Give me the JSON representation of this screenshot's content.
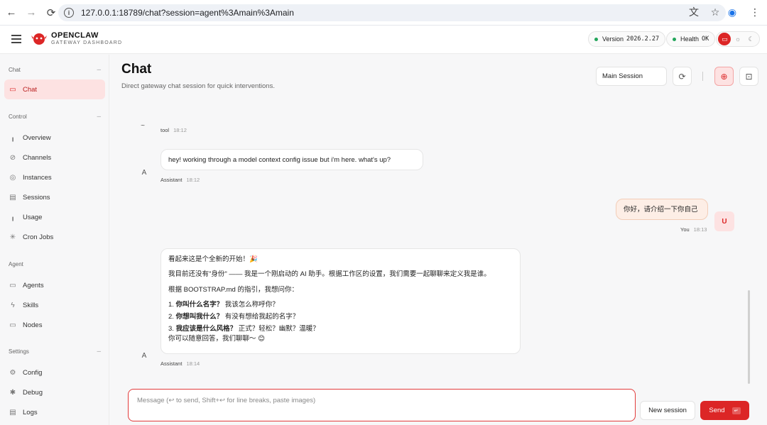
{
  "browser": {
    "url": "127.0.0.1:18789/chat?session=agent%3Amain%3Amain",
    "back_icon": "arrow-left-icon",
    "forward_icon": "arrow-right-icon",
    "reload_icon": "reload-icon"
  },
  "header": {
    "brand_title": "OPENCLAW",
    "brand_subtitle": "GATEWAY DASHBOARD",
    "version_label": "Version",
    "version_value": "2026.2.27",
    "health_label": "Health",
    "health_value": "OK",
    "status_color": "#22a55a",
    "accent_color": "#dc2626"
  },
  "sidebar": {
    "sections": [
      {
        "title": "Chat",
        "items": [
          {
            "label": "Chat",
            "icon": "chat-icon",
            "active": true
          }
        ]
      },
      {
        "title": "Control",
        "items": [
          {
            "label": "Overview",
            "icon": "bar-chart-icon"
          },
          {
            "label": "Channels",
            "icon": "link-icon"
          },
          {
            "label": "Instances",
            "icon": "radio-icon"
          },
          {
            "label": "Sessions",
            "icon": "file-icon"
          },
          {
            "label": "Usage",
            "icon": "bar-chart-icon"
          },
          {
            "label": "Cron Jobs",
            "icon": "loader-icon"
          }
        ]
      },
      {
        "title": "Agent",
        "items": [
          {
            "label": "Agents",
            "icon": "folder-icon"
          },
          {
            "label": "Skills",
            "icon": "zap-icon"
          },
          {
            "label": "Nodes",
            "icon": "monitor-icon"
          }
        ]
      },
      {
        "title": "Settings",
        "items": [
          {
            "label": "Config",
            "icon": "settings-icon"
          },
          {
            "label": "Debug",
            "icon": "bug-icon"
          },
          {
            "label": "Logs",
            "icon": "log-file-icon"
          }
        ]
      }
    ]
  },
  "main": {
    "title": "Chat",
    "subtitle": "Direct gateway chat session for quick interventions.",
    "session_select": "Main Session"
  },
  "messages": {
    "tool": {
      "sender": "tool",
      "time": "18:12",
      "avatar": "~"
    },
    "assistant1": {
      "text": "hey! working through a model context config issue but i'm here. what's up?",
      "sender": "Assistant",
      "time": "18:12",
      "avatar": "A"
    },
    "user1": {
      "text": "你好，请介绍一下你自己",
      "sender": "You",
      "time": "18:13",
      "avatar": "U"
    },
    "assistant2": {
      "line1": "看起来这是个全新的开始！🎉",
      "line2": "我目前还没有\"身份\" —— 我是一个刚启动的 AI 助手。根据工作区的设置，我们需要一起聊聊来定义我是谁。",
      "line3": "根据 BOOTSTRAP.md 的指引，我想问你：",
      "q1_num": "1.",
      "q1_bold": "你叫什么名字？",
      "q1_rest": " 我该怎么称呼你？",
      "q2_num": "2.",
      "q2_bold": "你想叫我什么？",
      "q2_rest": " 有没有想给我起的名字？",
      "q3_num": "3.",
      "q3_bold": "我应该是什么风格？",
      "q3_rest": " 正式？轻松？幽默？温暖？",
      "line_end": "你可以随意回答，我们聊聊～ 😊",
      "sender": "Assistant",
      "time": "18:14",
      "avatar": "A"
    }
  },
  "composer": {
    "placeholder": "Message (↩ to send, Shift+↩ for line breaks, paste images)",
    "new_session_label": "New session",
    "send_label": "Send"
  }
}
